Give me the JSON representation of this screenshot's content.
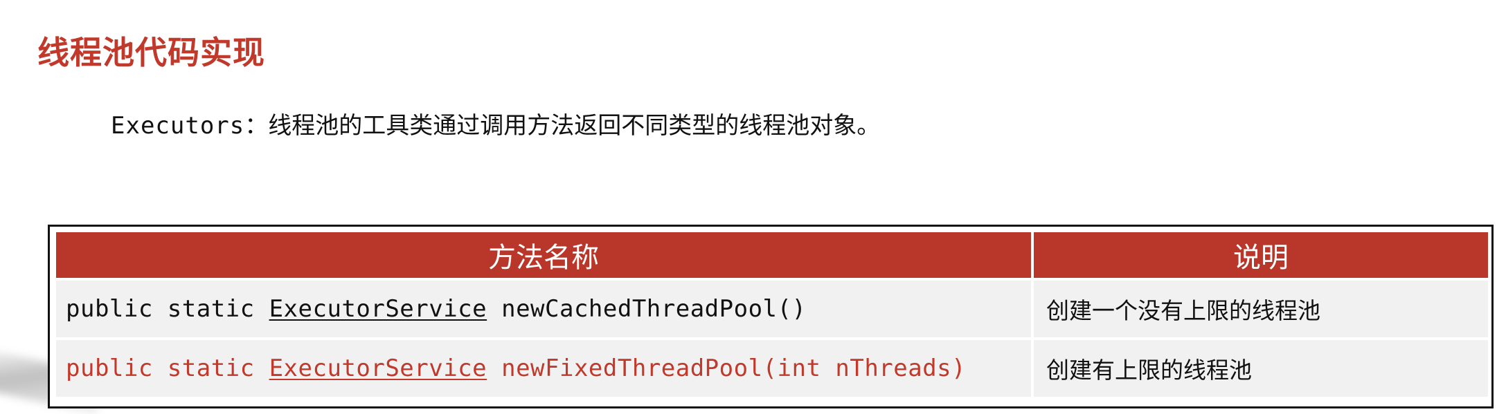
{
  "title": "线程池代码实现",
  "intro": {
    "keyword": "Executors",
    "separator": "：",
    "text": "线程池的工具类通过调用方法返回不同类型的线程池对象。"
  },
  "table": {
    "headers": [
      "方法名称",
      "说明"
    ],
    "rows": [
      {
        "modifiers": "public static ",
        "return_type": "ExecutorService",
        "method": " newCachedThreadPool()",
        "description": "创建一个没有上限的线程池",
        "highlighted": false
      },
      {
        "modifiers": "public static ",
        "return_type": "ExecutorService",
        "method": " newFixedThreadPool(int nThreads)",
        "description": "创建有上限的线程池",
        "highlighted": true
      }
    ]
  },
  "colors": {
    "accent": "#c0392b",
    "header_bg": "#b9372a",
    "cell_bg": "#f1f1f1"
  }
}
